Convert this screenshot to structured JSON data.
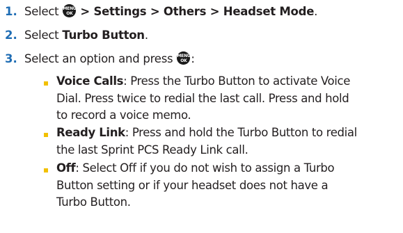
{
  "steps": [
    {
      "number": "1.",
      "prefix": "Select",
      "icon": "menu-ok-icon",
      "path": "> Settings > Others > Headset Mode",
      "suffix": "."
    },
    {
      "number": "2.",
      "prefix": "Select",
      "bold": "Turbo Button",
      "suffix": "."
    },
    {
      "number": "3.",
      "prefix": "Select an option and press",
      "icon": "menu-ok-icon",
      "suffix": ":"
    }
  ],
  "menu_icon": {
    "line1": "MENU",
    "line2": "OK"
  },
  "options": [
    {
      "term": "Voice Calls",
      "lines": [
        ": Press the Turbo Button to activate Voice",
        "Dial. Press twice to redial the last call. Press and hold",
        "to record a voice memo."
      ]
    },
    {
      "term": "Ready Link",
      "lines": [
        ": Press and hold the Turbo Button to redial",
        "the last Sprint PCS Ready Link call."
      ]
    },
    {
      "term": "Off",
      "lines": [
        ": Select Off if you do not wish to assign a Turbo",
        "Button setting or if your headset does not have a",
        "Turbo Button."
      ]
    }
  ],
  "colors": {
    "step_number": "#1f6db4",
    "bullet": "#f2c000",
    "text": "#231f20"
  }
}
